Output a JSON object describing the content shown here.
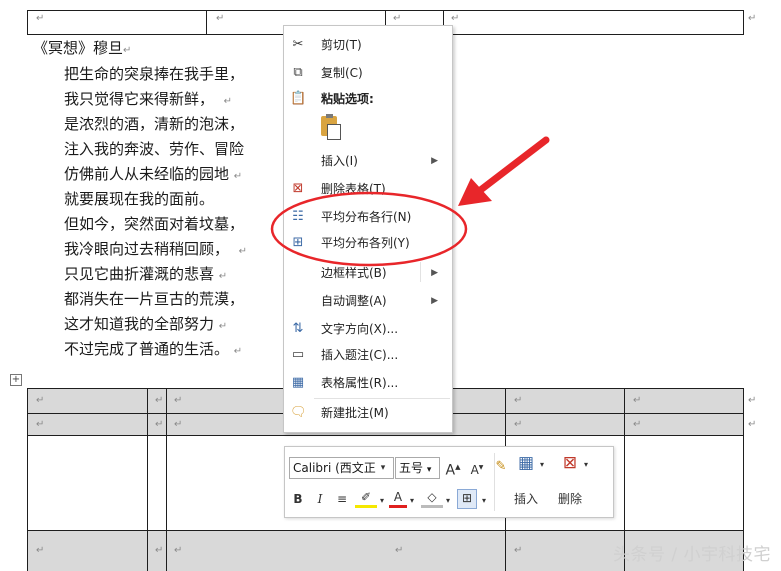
{
  "marks": {
    "paragraph": "↵"
  },
  "poem": {
    "title": "《冥想》穆旦",
    "lines": [
      "把生命的突泉捧在我手里，",
      "我只觉得它来得新鲜，",
      "是浓烈的酒，清新的泡沫，",
      "注入我的奔波、劳作、冒险",
      "仿佛前人从未经临的园地",
      "就要展现在我的面前。",
      "但如今，突然面对着坟墓，",
      "我冷眼向过去稍稍回顾，",
      "只见它曲折灌溉的悲喜",
      "都消失在一片亘古的荒漠，",
      "这才知道我的全部努力",
      "不过完成了普通的生活。"
    ]
  },
  "context_menu": {
    "cut": "剪切(T)",
    "copy": "复制(C)",
    "paste_options": "粘贴选项:",
    "insert": "插入(I)",
    "delete_table": "删除表格(T)",
    "distribute_rows": "平均分布各行(N)",
    "distribute_cols": "平均分布各列(Y)",
    "border_styles": "边框样式(B)",
    "autofit": "自动调整(A)",
    "text_direction": "文字方向(X)...",
    "insert_caption": "插入题注(C)...",
    "table_properties": "表格属性(R)...",
    "new_comment": "新建批注(M)"
  },
  "mini_toolbar": {
    "font": "Calibri (西文正",
    "size": "五号",
    "grow": "A",
    "shrink": "A",
    "bold": "B",
    "italic": "I",
    "font_color": "A",
    "insert": "插入",
    "delete": "删除"
  },
  "watermark": "头条号 / 小宇科技宅",
  "colors": {
    "annotation": "#e8262a",
    "shade": "#d9d9d9"
  }
}
